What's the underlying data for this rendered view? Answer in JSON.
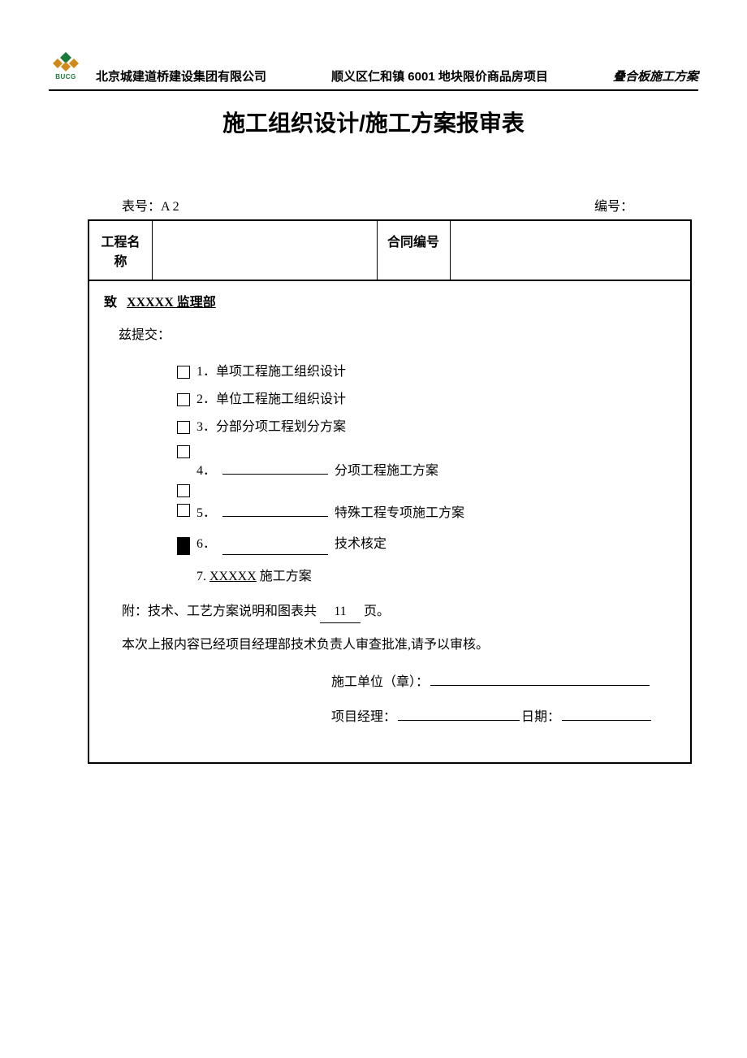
{
  "header": {
    "logo_text": "BUCG",
    "company": "北京城建道桥建设集团有限公司",
    "project": "顺义区仁和镇 6001 地块限价商品房项目",
    "doc_type": "叠合板施工方案"
  },
  "title": "施工组织设计/施工方案报审表",
  "meta": {
    "form_no_label": "表号：A 2",
    "serial_label": "编号："
  },
  "table_head": {
    "proj_name_label": "工程名称",
    "contract_no_label": "合同编号"
  },
  "body": {
    "recipient_prefix": "致",
    "recipient_name": "XXXXX 监理部",
    "intro": "兹提交：",
    "items": {
      "i1": "1．单项工程施工组织设计",
      "i2": "2．单位工程施工组织设计",
      "i3": "3．分部分项工程划分方案",
      "i4_prefix": "4．",
      "i4_suffix": "分项工程施工方案",
      "i5_prefix": "5．",
      "i5_suffix": "特殊工程专项施工方案",
      "i6_prefix": "6．",
      "i6_suffix": "技术核定",
      "i7_prefix": "7.",
      "i7_name": "XXXXX",
      "i7_suffix": " 施工方案"
    },
    "attach_prefix": "附：技术、工艺方案说明和图表共",
    "attach_pages": "11",
    "attach_suffix": "页。",
    "note": "本次上报内容已经项目经理部技术负责人审查批准,请予以审核。",
    "sig": {
      "unit_label": "施工单位（章）：",
      "pm_label": "项目经理：",
      "date_label": "日期："
    }
  }
}
